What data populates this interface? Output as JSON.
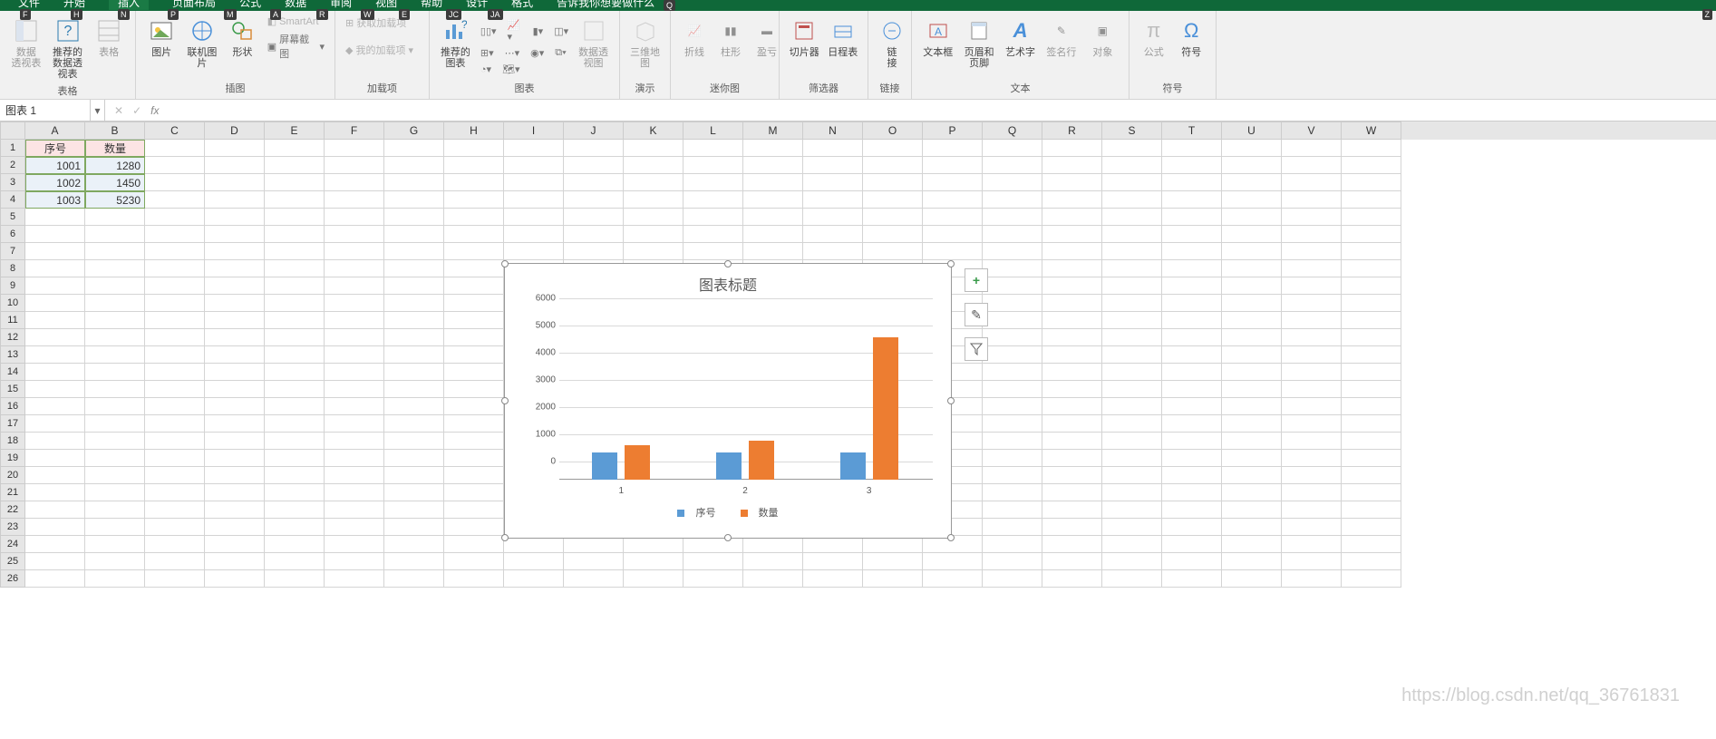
{
  "menubar": [
    "文件",
    "开始",
    "插入",
    "页面布局",
    "公式",
    "数据",
    "审阅",
    "视图",
    "帮助",
    "设计",
    "格式"
  ],
  "search_hint": "告诉我你想要做什么",
  "keytips": {
    "F": "F",
    "H": "H",
    "N": "N",
    "P": "P",
    "M": "M",
    "A": "A",
    "R": "R",
    "W": "W",
    "E": "E",
    "JC": "JC",
    "JA": "JA",
    "Q": "Q",
    "Z": "Z"
  },
  "ribbon": {
    "tables": {
      "pivot": "数据\n透视表",
      "rec_pivot": "推荐的\n数据透视表",
      "table": "表格",
      "label": "表格"
    },
    "illus": {
      "pic": "图片",
      "online": "联机图片",
      "shapes": "形状",
      "smartart": "SmartArt",
      "screenshot": "屏幕截图",
      "label": "插图"
    },
    "addins": {
      "get": "获取加载项",
      "my": "我的加载项",
      "label": "加载项"
    },
    "charts": {
      "rec": "推荐的\n图表",
      "pivotchart": "数据透视图",
      "map3d": "三维地\n图",
      "label": "图表",
      "demo_label": "演示"
    },
    "spark": {
      "line": "折线",
      "col": "柱形",
      "winloss": "盈亏",
      "label": "迷你图"
    },
    "filter": {
      "slicer": "切片器",
      "timeline": "日程表",
      "label": "筛选器"
    },
    "link": {
      "link": "链\n接",
      "label": "链接"
    },
    "text": {
      "textbox": "文本框",
      "header": "页眉和页脚",
      "wordart": "艺术字",
      "sig": "签名行",
      "obj": "对象",
      "label": "文本"
    },
    "sym": {
      "eq": "公式",
      "sym": "符号",
      "label": "符号"
    }
  },
  "namebox": "图表 1",
  "fx": "fx",
  "columns": [
    "A",
    "B",
    "C",
    "D",
    "E",
    "F",
    "G",
    "H",
    "I",
    "J",
    "K",
    "L",
    "M",
    "N",
    "O",
    "P",
    "Q",
    "R",
    "S",
    "T",
    "U",
    "V",
    "W"
  ],
  "sheet": {
    "headers": [
      "序号",
      "数量"
    ],
    "rows": [
      [
        "1001",
        "1280"
      ],
      [
        "1002",
        "1450"
      ],
      [
        "1003",
        "5230"
      ]
    ]
  },
  "chart_data": {
    "type": "bar",
    "title": "图表标题",
    "categories": [
      "1",
      "2",
      "3"
    ],
    "series": [
      {
        "name": "序号",
        "values": [
          1001,
          1002,
          1003
        ],
        "color": "#5b9bd5"
      },
      {
        "name": "数量",
        "values": [
          1280,
          1450,
          5230
        ],
        "color": "#ed7d31"
      }
    ],
    "ylim": [
      0,
      6000
    ],
    "yticks": [
      0,
      1000,
      2000,
      3000,
      4000,
      5000,
      6000
    ]
  },
  "side_btns": {
    "plus": "+",
    "brush": "✎",
    "filter": "▾"
  },
  "watermark": "https://blog.csdn.net/qq_36761831"
}
